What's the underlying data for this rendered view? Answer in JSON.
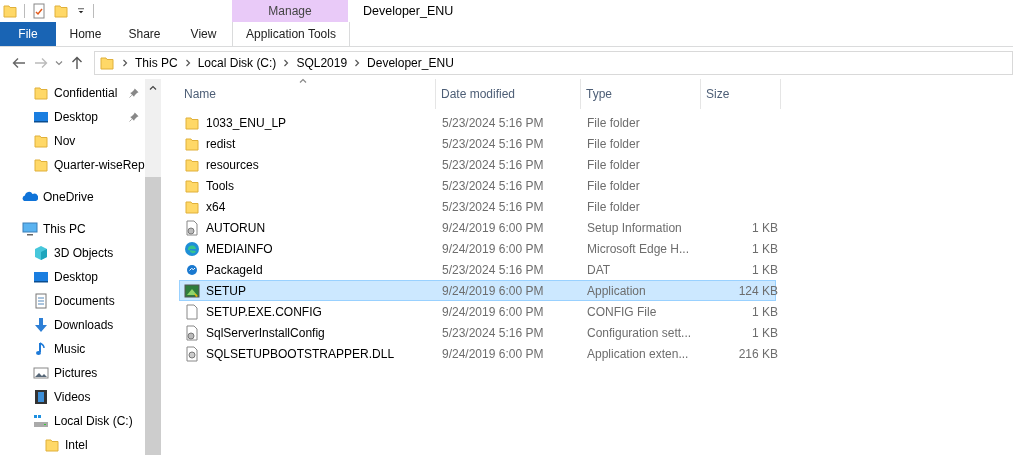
{
  "window": {
    "title": "Developer_ENU"
  },
  "ribbon": {
    "contextual_group": "Manage",
    "tabs": [
      {
        "label": "File",
        "kind": "file",
        "selected": false
      },
      {
        "label": "Home",
        "kind": "plain",
        "selected": false
      },
      {
        "label": "Share",
        "kind": "plain",
        "selected": false
      },
      {
        "label": "View",
        "kind": "plain",
        "selected": false
      },
      {
        "label": "Application Tools",
        "kind": "contextual",
        "selected": false
      }
    ]
  },
  "address_bar": {
    "path": [
      "This PC",
      "Local Disk (C:)",
      "SQL2019",
      "Developer_ENU"
    ]
  },
  "sidebar": {
    "quick_access": [
      {
        "label": "Confidential",
        "kind": "folder",
        "pinned": true
      },
      {
        "label": "Desktop",
        "kind": "desktop",
        "pinned": true
      },
      {
        "label": "Nov",
        "kind": "folder",
        "pinned": false
      },
      {
        "label": "Quarter-wiseRep",
        "kind": "folder",
        "pinned": false
      }
    ],
    "tree": [
      {
        "label": "OneDrive",
        "kind": "onedrive"
      },
      {
        "label": "This PC",
        "kind": "pc",
        "children": [
          {
            "label": "3D Objects",
            "kind": "cube"
          },
          {
            "label": "Desktop",
            "kind": "desktop"
          },
          {
            "label": "Documents",
            "kind": "documents"
          },
          {
            "label": "Downloads",
            "kind": "downloads"
          },
          {
            "label": "Music",
            "kind": "music"
          },
          {
            "label": "Pictures",
            "kind": "pictures"
          },
          {
            "label": "Videos",
            "kind": "videos"
          },
          {
            "label": "Local Disk (C:)",
            "kind": "disk",
            "children": [
              {
                "label": "Intel",
                "kind": "folder"
              }
            ]
          }
        ]
      }
    ]
  },
  "table": {
    "columns": [
      "Name",
      "Date modified",
      "Type",
      "Size"
    ],
    "rows": [
      {
        "name": "1033_ENU_LP",
        "kind": "folder",
        "date": "5/23/2024 5:16 PM",
        "type": "File folder",
        "selected": false
      },
      {
        "name": "redist",
        "kind": "folder",
        "date": "5/23/2024 5:16 PM",
        "type": "File folder",
        "selected": false
      },
      {
        "name": "resources",
        "kind": "folder",
        "date": "5/23/2024 5:16 PM",
        "type": "File folder",
        "selected": false
      },
      {
        "name": "Tools",
        "kind": "folder",
        "date": "5/23/2024 5:16 PM",
        "type": "File folder",
        "selected": false
      },
      {
        "name": "x64",
        "kind": "folder",
        "date": "5/23/2024 5:16 PM",
        "type": "File folder",
        "selected": false
      },
      {
        "name": "AUTORUN",
        "kind": "settings",
        "date": "9/24/2019 6:00 PM",
        "type": "Setup Information",
        "size": "1 KB",
        "selected": false
      },
      {
        "name": "MEDIAINFO",
        "kind": "edge",
        "date": "9/24/2019 6:00 PM",
        "type": "Microsoft Edge H...",
        "size": "1 KB",
        "selected": false
      },
      {
        "name": "PackageId",
        "kind": "dat",
        "date": "5/23/2024 5:16 PM",
        "type": "DAT",
        "size": "1 KB",
        "selected": false
      },
      {
        "name": "SETUP",
        "kind": "app",
        "date": "9/24/2019 6:00 PM",
        "type": "Application",
        "size": "124 KB",
        "selected": true
      },
      {
        "name": "SETUP.EXE.CONFIG",
        "kind": "file",
        "date": "9/24/2019 6:00 PM",
        "type": "CONFIG File",
        "size": "1 KB",
        "selected": false
      },
      {
        "name": "SqlServerInstallConfig",
        "kind": "settings",
        "date": "5/23/2024 5:16 PM",
        "type": "Configuration sett...",
        "size": "1 KB",
        "selected": false
      },
      {
        "name": "SQLSETUPBOOTSTRAPPER.DLL",
        "kind": "dll",
        "date": "9/24/2019 6:00 PM",
        "type": "Application exten...",
        "size": "216 KB",
        "selected": false
      }
    ]
  }
}
